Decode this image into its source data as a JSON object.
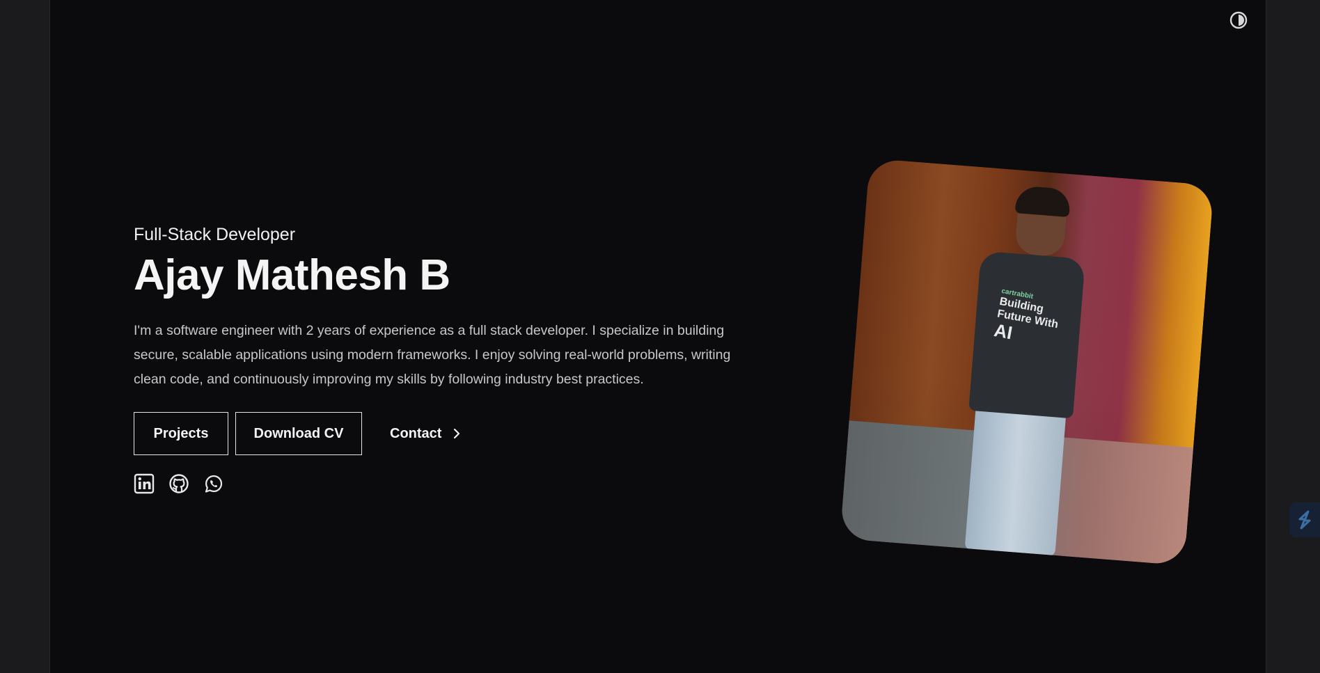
{
  "hero": {
    "subtitle": "Full-Stack Developer",
    "name": "Ajay Mathesh B",
    "bio": "I'm a software engineer with 2 years of experience as a full stack developer. I specialize in building secure, scalable applications using modern frameworks. I enjoy solving real-world problems, writing clean code, and continuously improving my skills by following industry best practices."
  },
  "actions": {
    "projects_label": "Projects",
    "download_cv_label": "Download CV",
    "contact_label": "Contact"
  },
  "socials": [
    {
      "icon": "linkedin-icon"
    },
    {
      "icon": "github-icon"
    },
    {
      "icon": "whatsapp-icon"
    }
  ],
  "photo": {
    "shirt_text_small": "cartrabbit",
    "shirt_text_lines": "Building Future With",
    "shirt_text_big": "AI"
  },
  "icons": {
    "theme_toggle": "theme-toggle-icon",
    "contact_arrow": "chevron-right-icon",
    "side_widget": "extension-logo-icon"
  },
  "colors": {
    "background": "#0b0b0e",
    "outer": "#1b1b1d",
    "text": "#f4f4f4",
    "muted_text": "#c8c8cc",
    "side_widget": "#162234",
    "side_widget_accent": "#3a6ea5"
  }
}
